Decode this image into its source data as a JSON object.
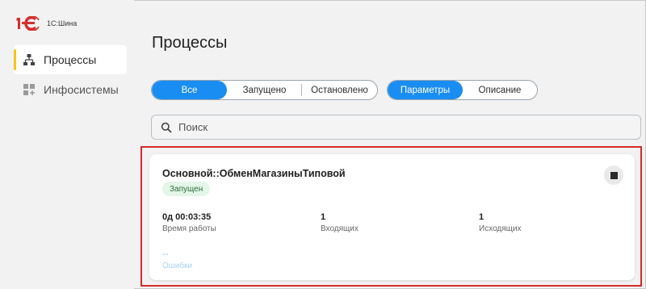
{
  "app": {
    "name": "1С:Шина"
  },
  "sidebar": {
    "items": [
      {
        "label": "Процессы",
        "icon": "hierarchy-icon",
        "active": true
      },
      {
        "label": "Инфосистемы",
        "icon": "grid-plus-icon",
        "active": false
      }
    ]
  },
  "page": {
    "title": "Процессы"
  },
  "status_filter": {
    "options": [
      "Все",
      "Запущено",
      "Остановлено"
    ],
    "selected": "Все"
  },
  "view_filter": {
    "options": [
      "Параметры",
      "Описание"
    ],
    "selected": "Параметры"
  },
  "search": {
    "placeholder": "Поиск",
    "value": ""
  },
  "process": {
    "name": "Основной::ОбменМагазиныТиповой",
    "status": "Запущен",
    "metrics": [
      {
        "value": "0д 00:03:35",
        "label": "Время работы"
      },
      {
        "value": "1",
        "label": "Входящих"
      },
      {
        "value": "1",
        "label": "Исходящих"
      }
    ],
    "errors": {
      "value": "--",
      "label": "Ошибки"
    }
  },
  "colors": {
    "accent": "#1a8df2",
    "active_marker": "#f6c31c",
    "highlight": "#d62a2a",
    "status_bg": "#e3f6e8",
    "logo_red": "#d32f2f"
  }
}
